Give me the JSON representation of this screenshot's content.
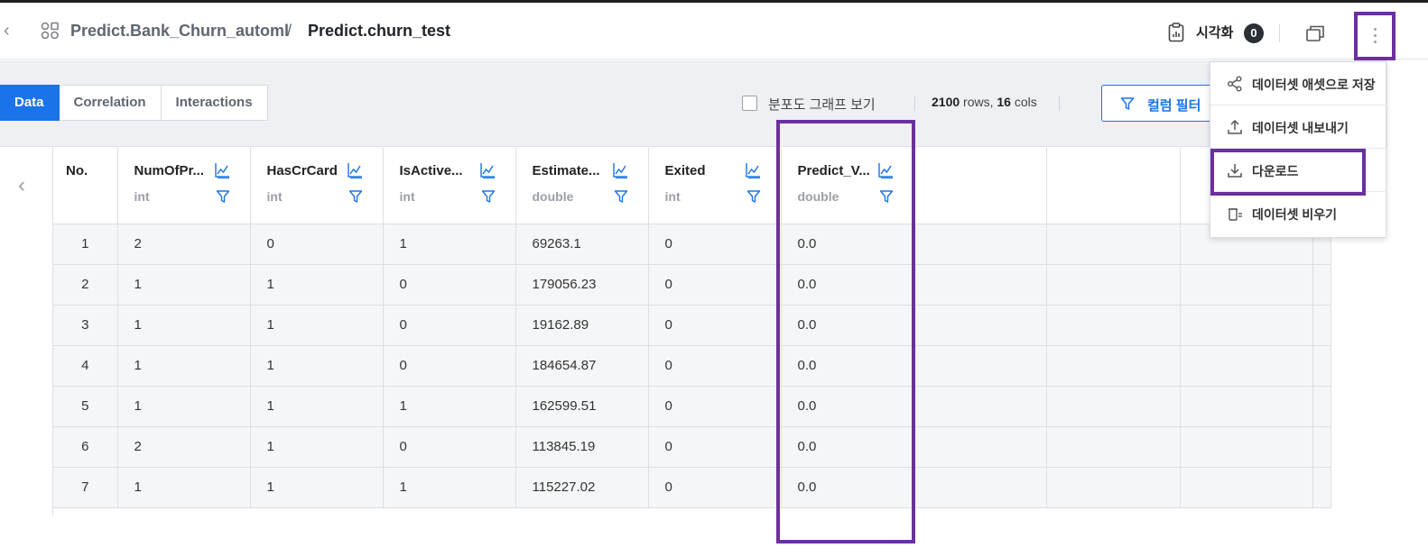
{
  "header": {
    "breadcrumb_parent": "Predict.Bank_Churn_automl",
    "breadcrumb_separator": "/",
    "breadcrumb_current": "Predict.churn_test",
    "visualize_label": "시각화",
    "visualize_count": "0",
    "icons": [
      "back-chevron-icon",
      "dataset-grid-icon",
      "clipboard-chart-icon",
      "new-window-icon",
      "more-vertical-icon"
    ]
  },
  "toolbar": {
    "tabs": [
      {
        "label": "Data",
        "active": true
      },
      {
        "label": "Correlation",
        "active": false
      },
      {
        "label": "Interactions",
        "active": false
      }
    ],
    "distribution_checkbox_label": "분포도 그래프 보기",
    "distribution_checked": false,
    "rows_count": "2100",
    "rows_word": "rows,",
    "cols_count": "16",
    "cols_word": "cols",
    "column_filter_label": "컬럼 필터"
  },
  "table": {
    "no_header": "No.",
    "columns": [
      {
        "name": "NumOfPr...",
        "type": "int"
      },
      {
        "name": "HasCrCard",
        "type": "int"
      },
      {
        "name": "IsActive...",
        "type": "int"
      },
      {
        "name": "Estimate...",
        "type": "double"
      },
      {
        "name": "Exited",
        "type": "int"
      },
      {
        "name": "Predict_V...",
        "type": "double"
      }
    ],
    "rows": [
      [
        "1",
        "2",
        "0",
        "1",
        "69263.1",
        "0",
        "0.0"
      ],
      [
        "2",
        "1",
        "1",
        "0",
        "179056.23",
        "0",
        "0.0"
      ],
      [
        "3",
        "1",
        "1",
        "0",
        "19162.89",
        "0",
        "0.0"
      ],
      [
        "4",
        "1",
        "1",
        "0",
        "184654.87",
        "0",
        "0.0"
      ],
      [
        "5",
        "1",
        "1",
        "1",
        "162599.51",
        "0",
        "0.0"
      ],
      [
        "6",
        "2",
        "1",
        "0",
        "113845.19",
        "0",
        "0.0"
      ],
      [
        "7",
        "1",
        "1",
        "1",
        "115227.02",
        "0",
        "0.0"
      ]
    ]
  },
  "menu": {
    "items": [
      {
        "label": "데이터셋 애셋으로 저장",
        "icon": "share-icon"
      },
      {
        "label": "데이터셋 내보내기",
        "icon": "upload-icon"
      },
      {
        "label": "다운로드",
        "icon": "download-icon"
      },
      {
        "label": "데이터셋 비우기",
        "icon": "clear-dataset-icon"
      }
    ]
  },
  "colors": {
    "accent": "#1a73e8",
    "highlight": "#6b2fa0",
    "badge": "#2b2f36"
  }
}
